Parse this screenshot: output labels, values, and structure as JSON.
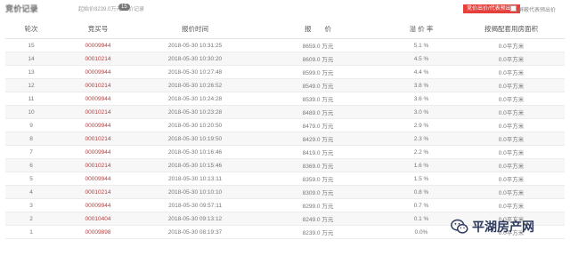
{
  "topbar": {
    "title": "竞价记录",
    "info": "起始价8239.0万元 出价记录",
    "count_badge": "15",
    "red_button": "竞价出价/代表预出价",
    "checkbox_label": "屏蔽代表预出价"
  },
  "table": {
    "headers": [
      "轮次",
      "竞买号",
      "报价时间",
      "报　　价",
      "溢 价 率",
      "按揭配套用房面积"
    ],
    "rows": [
      {
        "round": "15",
        "bidder": "00009944",
        "time": "2018-05-30 10:31:25",
        "price": "8659.0 万元",
        "premium": "5.1 %",
        "area": "0.0平方米"
      },
      {
        "round": "14",
        "bidder": "00010214",
        "time": "2018-05-30 10:30:20",
        "price": "8609.0 万元",
        "premium": "4.5 %",
        "area": "0.0平方米"
      },
      {
        "round": "13",
        "bidder": "00009944",
        "time": "2018-05-30 10:27:48",
        "price": "8599.0 万元",
        "premium": "4.4 %",
        "area": "0.0平方米"
      },
      {
        "round": "12",
        "bidder": "00010214",
        "time": "2018-05-30 10:26:52",
        "price": "8549.0 万元",
        "premium": "3.8 %",
        "area": "0.0平方米"
      },
      {
        "round": "11",
        "bidder": "00009944",
        "time": "2018-05-30 10:24:28",
        "price": "8539.0 万元",
        "premium": "3.6 %",
        "area": "0.0平方米"
      },
      {
        "round": "10",
        "bidder": "00010214",
        "time": "2018-05-30 10:23:28",
        "price": "8489.0 万元",
        "premium": "3.0 %",
        "area": "0.0平方米"
      },
      {
        "round": "9",
        "bidder": "00009944",
        "time": "2018-05-30 10:20:50",
        "price": "8479.0 万元",
        "premium": "2.9 %",
        "area": "0.0平方米"
      },
      {
        "round": "8",
        "bidder": "00010214",
        "time": "2018-05-30 10:19:50",
        "price": "8429.0 万元",
        "premium": "2.3 %",
        "area": "0.0平方米"
      },
      {
        "round": "7",
        "bidder": "00009944",
        "time": "2018-05-30 10:16:46",
        "price": "8419.0 万元",
        "premium": "2.2 %",
        "area": "0.0平方米"
      },
      {
        "round": "6",
        "bidder": "00010214",
        "time": "2018-05-30 10:15:46",
        "price": "8369.0 万元",
        "premium": "1.6 %",
        "area": "0.0平方米"
      },
      {
        "round": "5",
        "bidder": "00009944",
        "time": "2018-05-30 10:13:11",
        "price": "8359.0 万元",
        "premium": "1.5 %",
        "area": "0.0平方米"
      },
      {
        "round": "4",
        "bidder": "00010214",
        "time": "2018-05-30 10:10:10",
        "price": "8309.0 万元",
        "premium": "0.8 %",
        "area": "0.0平方米"
      },
      {
        "round": "3",
        "bidder": "00009944",
        "time": "2018-05-30 09:57:11",
        "price": "8299.0 万元",
        "premium": "0.7 %",
        "area": "0.0平方米"
      },
      {
        "round": "2",
        "bidder": "00010404",
        "time": "2018-05-30 09:13:12",
        "price": "8249.0 万元",
        "premium": "0.1 %",
        "area": "0.0平方米"
      },
      {
        "round": "1",
        "bidder": "00009898",
        "time": "2018-05-30 08:19:37",
        "price": "8239.0 万元",
        "premium": "0.0%",
        "area": "0.0平方米"
      }
    ]
  },
  "watermark": {
    "text": "平湖房产网",
    "icon": "wechat-icon"
  },
  "colors": {
    "bidder_text": "#b14040",
    "accent_red": "#e5403c",
    "row_alt": "#f7f7f7"
  }
}
